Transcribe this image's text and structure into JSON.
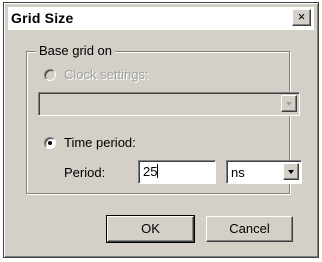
{
  "window": {
    "title": "Grid Size",
    "close_glyph": "×"
  },
  "group": {
    "legend": "Base grid on"
  },
  "clock_option": {
    "label": "Clock settings:",
    "selected": false,
    "enabled": false,
    "combo_value": ""
  },
  "time_option": {
    "label": "Time period:",
    "selected": true,
    "enabled": true
  },
  "period": {
    "label": "Period:",
    "value": "25",
    "unit": "ns"
  },
  "buttons": {
    "ok": "OK",
    "cancel": "Cancel"
  },
  "icons": {
    "close": "close-icon",
    "dropdown": "chevron-down-icon"
  }
}
